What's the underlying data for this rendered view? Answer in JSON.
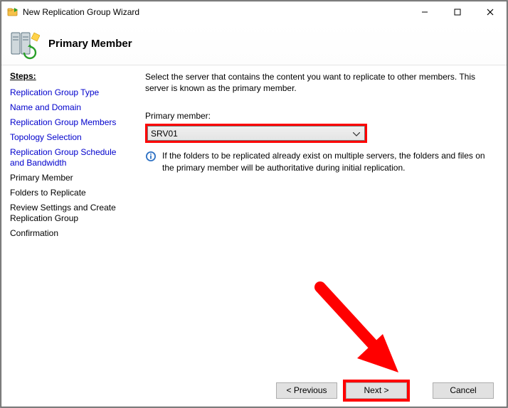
{
  "window": {
    "title": "New Replication Group Wizard"
  },
  "page": {
    "title": "Primary Member"
  },
  "sidebar": {
    "header": "Steps:",
    "steps": [
      {
        "label": "Replication Group Type",
        "state": "link"
      },
      {
        "label": "Name and Domain",
        "state": "link"
      },
      {
        "label": "Replication Group Members",
        "state": "link"
      },
      {
        "label": "Topology Selection",
        "state": "link"
      },
      {
        "label": "Replication Group Schedule and Bandwidth",
        "state": "link"
      },
      {
        "label": "Primary Member",
        "state": "current"
      },
      {
        "label": "Folders to Replicate",
        "state": "future"
      },
      {
        "label": "Review Settings and Create Replication Group",
        "state": "future"
      },
      {
        "label": "Confirmation",
        "state": "future"
      }
    ]
  },
  "main": {
    "description": "Select the server that contains the content you want to replicate to other members. This server is known as the primary member.",
    "field_label": "Primary member:",
    "primary_member_value": "SRV01",
    "info_text": "If the folders to be replicated already exist on multiple servers, the folders and files on the primary member will be authoritative during initial replication."
  },
  "buttons": {
    "previous": "< Previous",
    "next": "Next >",
    "cancel": "Cancel"
  },
  "annotations": {
    "combo_highlight_color": "#ff0000",
    "next_highlight_color": "#ff0000",
    "arrow_color": "#ff0000"
  }
}
